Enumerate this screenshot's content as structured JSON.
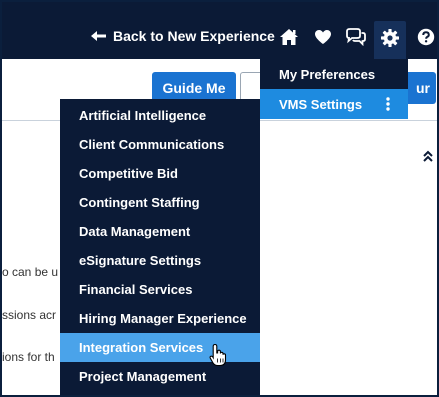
{
  "topnav": {
    "back_label": "Back to New Experience",
    "icons": [
      "arrow-left-icon",
      "home-icon",
      "heart-icon",
      "chat-icon",
      "gear-icon",
      "help-icon"
    ]
  },
  "toolbar": {
    "guide_me_label": "Guide Me",
    "right_button_partial": "ur"
  },
  "background_text": {
    "line1": "o can be u",
    "line2": "ssions acr",
    "line3": "ions for th"
  },
  "settings_menu": {
    "items": [
      {
        "label": "My Preferences"
      },
      {
        "label": "VMS Settings",
        "active": true
      }
    ]
  },
  "vms_submenu": {
    "items": [
      {
        "label": "Artificial Intelligence"
      },
      {
        "label": "Client Communications"
      },
      {
        "label": "Competitive Bid"
      },
      {
        "label": "Contingent Staffing"
      },
      {
        "label": "Data Management"
      },
      {
        "label": "eSignature Settings"
      },
      {
        "label": "Financial Services"
      },
      {
        "label": "Hiring Manager Experience"
      },
      {
        "label": "Integration Services",
        "hover": true
      },
      {
        "label": "Project Management"
      }
    ]
  },
  "colors": {
    "nav_bg": "#0b1a36",
    "active_item": "#1e8be0",
    "hover_item": "#4aa3ea",
    "primary_button": "#1a73d1"
  }
}
